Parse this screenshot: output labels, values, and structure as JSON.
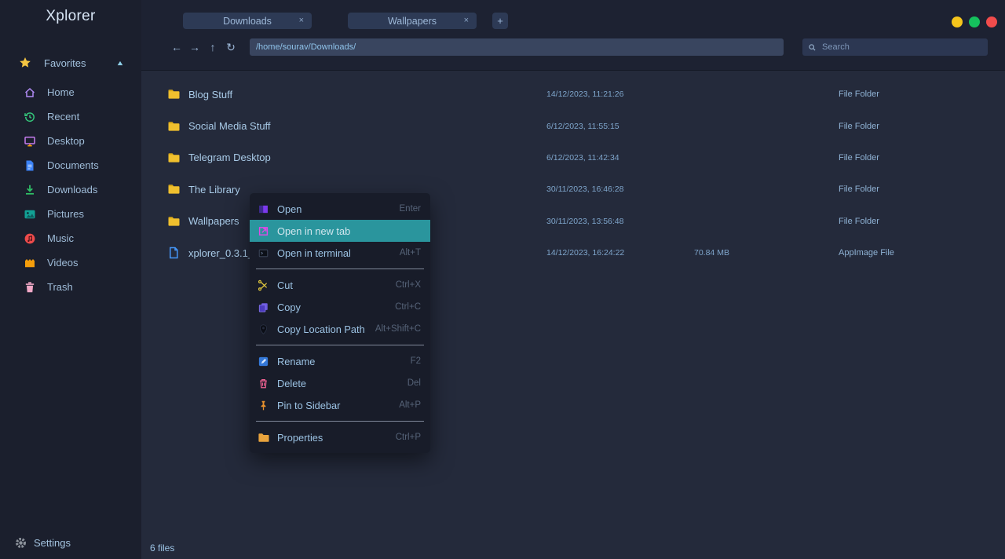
{
  "window": {
    "traffic_lights": {
      "yellow": "#f5c51c",
      "green": "#15c15d",
      "red": "#f14c4c"
    }
  },
  "colors": {
    "sidebar_bg": "#1b1f2d",
    "header_bg": "#1d2232",
    "main_bg": "#242a3b",
    "menu_bg": "#181c29",
    "tab_bg": "#2d3a55",
    "highlight": "#2a959d",
    "folder_yellow": "#f0c02e"
  },
  "sidebar": {
    "title": "Xplorer",
    "section": {
      "label": "Favorites",
      "icon": "star-icon",
      "collapse_icon": "triangle-up-icon"
    },
    "items": [
      {
        "label": "Home",
        "icon": "home-icon"
      },
      {
        "label": "Recent",
        "icon": "recent-icon"
      },
      {
        "label": "Desktop",
        "icon": "desktop-icon"
      },
      {
        "label": "Documents",
        "icon": "documents-icon"
      },
      {
        "label": "Downloads",
        "icon": "downloads-icon"
      },
      {
        "label": "Pictures",
        "icon": "pictures-icon"
      },
      {
        "label": "Music",
        "icon": "music-icon"
      },
      {
        "label": "Videos",
        "icon": "videos-icon"
      },
      {
        "label": "Trash",
        "icon": "trash-icon"
      }
    ],
    "settings": {
      "label": "Settings",
      "icon": "gear-icon"
    }
  },
  "tabs": [
    {
      "label": "Downloads",
      "close": "×"
    },
    {
      "label": "Wallpapers",
      "close": "×"
    }
  ],
  "new_tab_label": "+",
  "navigation": {
    "back_glyph": "←",
    "forward_glyph": "→",
    "up_glyph": "↑",
    "refresh_glyph": "↻",
    "path_value": "/home/sourav/Downloads/",
    "search_placeholder": "Search",
    "search_icon": "search-icon"
  },
  "files": [
    {
      "name": "Blog Stuff",
      "modified": "14/12/2023, 11:21:26",
      "size": "",
      "type": "File Folder",
      "icon": "folder-icon"
    },
    {
      "name": "Social Media Stuff",
      "modified": "6/12/2023, 11:55:15",
      "size": "",
      "type": "File Folder",
      "icon": "folder-icon"
    },
    {
      "name": "Telegram Desktop",
      "modified": "6/12/2023, 11:42:34",
      "size": "",
      "type": "File Folder",
      "icon": "folder-icon"
    },
    {
      "name": "The Library",
      "modified": "30/11/2023, 16:46:28",
      "size": "",
      "type": "File Folder",
      "icon": "folder-icon"
    },
    {
      "name": "Wallpapers",
      "modified": "30/11/2023, 13:56:48",
      "size": "",
      "type": "File Folder",
      "icon": "folder-icon"
    },
    {
      "name": "xplorer_0.3.1_",
      "modified": "14/12/2023, 16:24:22",
      "size": "70.84 MB",
      "type": "AppImage File",
      "icon": "file-icon"
    }
  ],
  "context_menu": {
    "items": [
      {
        "label": "Open",
        "shortcut": "Enter",
        "icon": "open-icon"
      },
      {
        "label": "Open in new tab",
        "shortcut": "",
        "icon": "open-new-tab-icon",
        "highlighted": true
      },
      {
        "label": "Open in terminal",
        "shortcut": "Alt+T",
        "icon": "terminal-icon"
      },
      {
        "type": "separator"
      },
      {
        "label": "Cut",
        "shortcut": "Ctrl+X",
        "icon": "cut-icon"
      },
      {
        "label": "Copy",
        "shortcut": "Ctrl+C",
        "icon": "copy-icon"
      },
      {
        "label": "Copy Location Path",
        "shortcut": "Alt+Shift+C",
        "icon": "location-pin-icon"
      },
      {
        "type": "separator"
      },
      {
        "label": "Rename",
        "shortcut": "F2",
        "icon": "rename-icon"
      },
      {
        "label": "Delete",
        "shortcut": "Del",
        "icon": "delete-icon"
      },
      {
        "label": "Pin to Sidebar",
        "shortcut": "Alt+P",
        "icon": "pin-icon"
      },
      {
        "type": "separator"
      },
      {
        "label": "Properties",
        "shortcut": "Ctrl+P",
        "icon": "properties-icon"
      }
    ]
  },
  "status_bar": {
    "file_count": "6 files"
  }
}
